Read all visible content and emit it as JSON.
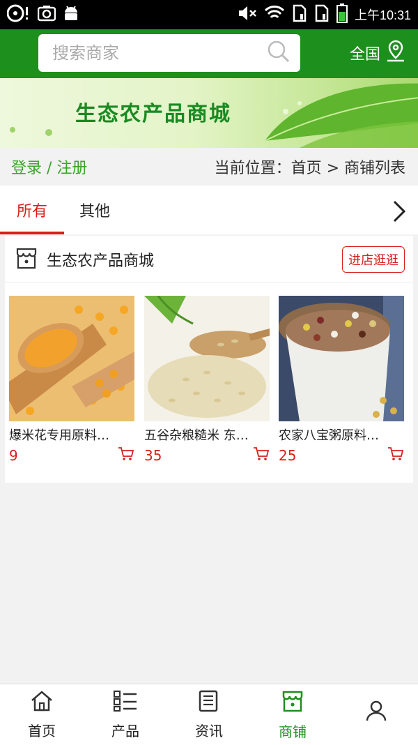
{
  "status_bar": {
    "time": "上午10:31",
    "icons": [
      "media-icon",
      "screenshot-icon",
      "android-icon",
      "mute-icon",
      "wifi-icon",
      "sim1-icon",
      "sim2-icon",
      "battery-icon"
    ]
  },
  "header": {
    "search_placeholder": "搜索商家",
    "region_label": "全国",
    "brand_color": "#1d8f1d"
  },
  "banner": {
    "title": "生态农产品商城"
  },
  "breadcrumb": {
    "login_label": "登录 / 注册",
    "location": "当前位置：首页 > 商铺列表"
  },
  "tabs": [
    {
      "label": "所有",
      "active": true
    },
    {
      "label": "其他",
      "active": false
    }
  ],
  "store": {
    "name": "生态农产品商城",
    "enter_label": "进店逛逛",
    "products": [
      {
        "name": "爆米花专用原料…",
        "price": "9"
      },
      {
        "name": "五谷杂粮糙米 东…",
        "price": "35"
      },
      {
        "name": "农家八宝粥原料…",
        "price": "25"
      }
    ]
  },
  "bottom_nav": [
    {
      "label": "首页",
      "icon": "home-icon",
      "active": false
    },
    {
      "label": "产品",
      "icon": "list-icon",
      "active": false
    },
    {
      "label": "资讯",
      "icon": "news-icon",
      "active": false
    },
    {
      "label": "商铺",
      "icon": "shop-icon",
      "active": true
    },
    {
      "label": "",
      "icon": "user-icon",
      "active": false
    }
  ],
  "colors": {
    "accent_red": "#d81e1e",
    "green": "#1d8f1d"
  }
}
